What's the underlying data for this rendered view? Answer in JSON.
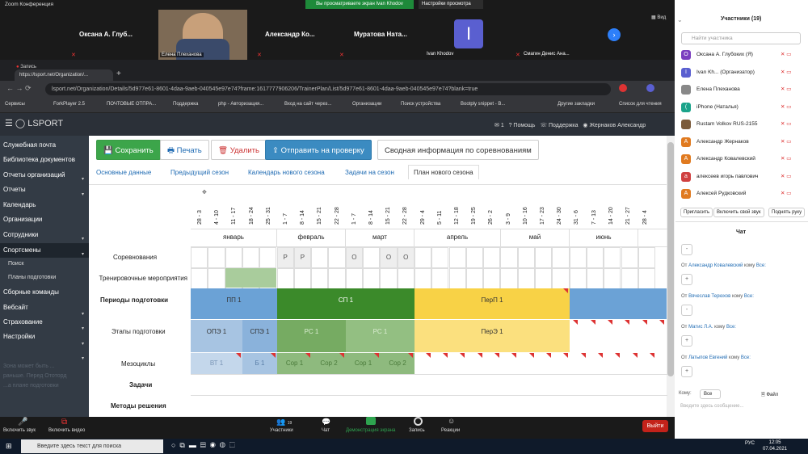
{
  "zoom": {
    "window_title": "Zoom Конференция",
    "sharing_banner": "Вы просматриваете экран Ivan Khodov",
    "view_options": "Настройки просмотра",
    "view_label": "Вид",
    "tiles": [
      {
        "name": "Оксана А. Глуб..."
      },
      {
        "name": "Елена Плеханова",
        "video": true
      },
      {
        "name": "Александр Ко..."
      },
      {
        "name": "Муратова Ната..."
      },
      {
        "name": "Ivan Khodov",
        "initial": "I"
      },
      {
        "name": "Смагин Денис Ана..."
      }
    ],
    "controls": {
      "mute": "Включить звук",
      "video": "Включить видео",
      "participants": "Участники",
      "participants_count": "19",
      "chat": "Чат",
      "share": "Демонстрация экрана",
      "record": "Запись",
      "reactions": "Реакции",
      "leave": "Выйти"
    }
  },
  "browser": {
    "recording_label": "Запись",
    "tab_title": "https://lsport.net/Organization/...",
    "url": "lsport.net/Organization/Details/5d977e61-8601-4daa-9aeb-040545e97e74?frame:1617777906206/TrainerPlan/List/5d977e61-8601-4daa-9aeb-040545e97e74?blank=true",
    "bookmarks": [
      "Сервисы",
      "ForkPlayer 2.5",
      "ПОЧТОВЫЕ ОТПРА...",
      "Поддержка",
      "php - Авторизация...",
      "Вход на сайт через...",
      "Организации",
      "Поиск устройства",
      "Bootply snippet - B...",
      "Другие закладки",
      "Список для чтения"
    ]
  },
  "app": {
    "logo": "LSPORT",
    "header": {
      "notifications": "1",
      "help": "Помощь",
      "support": "Поддержка",
      "user": "Жернаков Александр"
    },
    "sidebar": [
      {
        "label": "Служебная почта"
      },
      {
        "label": "Библиотека документов"
      },
      {
        "label": "Отчеты организаций",
        "arrow": true
      },
      {
        "label": "Отчеты",
        "arrow": true
      },
      {
        "label": "Календарь"
      },
      {
        "label": "Организации"
      },
      {
        "label": "Сотрудники",
        "arrow": true
      },
      {
        "label": "Спортсмены",
        "arrow": true,
        "active": true
      },
      {
        "label": "Поиск",
        "sub": true
      },
      {
        "label": "Планы подготовки",
        "sub": true
      },
      {
        "label": "Сборные команды",
        "arrow": true
      },
      {
        "label": "Вебсайт",
        "arrow": true
      },
      {
        "label": "Страхование",
        "arrow": true
      },
      {
        "label": "Настройки",
        "arrow": true
      }
    ],
    "sidebar_faded": "Зона может быть ...\nраньше. Перед Ототорд\n...а плане подготовки",
    "toolbar": {
      "save": "Сохранить",
      "print": "Печать",
      "delete": "Удалить",
      "submit": "Отправить на проверку",
      "summary": "Сводная информация по соревнованиям"
    },
    "tabs": [
      "Основные данные",
      "Предыдущий сезон",
      "Календарь нового сезона",
      "Задачи на сезон",
      "План нового сезона"
    ],
    "weeks": [
      "28 - 3",
      "4 - 10",
      "11 - 17",
      "18 - 24",
      "25 - 31",
      "1 - 7",
      "8 - 14",
      "15 - 21",
      "22 - 28",
      "1 - 7",
      "8 - 14",
      "15 - 21",
      "22 - 28",
      "29 - 4",
      "5 - 11",
      "12 - 18",
      "19 - 25",
      "26 - 2",
      "3 - 9",
      "10 - 16",
      "17 - 23",
      "24 - 30",
      "31 - 6",
      "7 - 13",
      "14 - 20",
      "21 - 27",
      "28 - 4"
    ],
    "months": [
      "январь",
      "февраль",
      "март",
      "апрель",
      "май",
      "июнь"
    ],
    "rows": {
      "competitions": "Соревнования",
      "training_events": "Тренировочные мероприятия",
      "periods": "Периоды подготовки",
      "stages": "Этапы подготовки",
      "mesocycles": "Мезоциклы",
      "tasks": "Задачи",
      "methods": "Методы решения"
    },
    "competition_marks": [
      "Р",
      "Р",
      "О",
      "О",
      "О"
    ],
    "periods": [
      "ПП 1",
      "СП 1",
      "ПерП 1"
    ],
    "stages": [
      "ОПЭ 1",
      "СПЭ 1",
      "РС 1",
      "РС 1",
      "ПерЭ 1"
    ],
    "mesocycles": [
      "ВТ 1",
      "Б 1",
      "Сор 1",
      "Сор 2",
      "Сор 1",
      "Сор 2"
    ]
  },
  "participants": {
    "title": "Участники (19)",
    "search_placeholder": "Найти участника",
    "list": [
      {
        "initial": "О",
        "name": "Оксана А. Глубоких (Я)",
        "color": "#7b3fbf"
      },
      {
        "initial": "I",
        "name": "Ivan Kh... (Организатор)",
        "color": "#5a5fd0"
      },
      {
        "initial": "",
        "name": "Елена Плеханова",
        "color": "#888"
      },
      {
        "initial": "(",
        "name": "iPhone (Наталья)",
        "color": "#1aa38a"
      },
      {
        "initial": "",
        "name": "Rustam Volkov RUS-2155",
        "color": "#7a5a3a"
      },
      {
        "initial": "А",
        "name": "Александр Жернаков",
        "color": "#e07a20"
      },
      {
        "initial": "А",
        "name": "Александр Ковалевский",
        "color": "#e07a20"
      },
      {
        "initial": "а",
        "name": "алексеев игорь павлович",
        "color": "#d04040"
      },
      {
        "initial": "А",
        "name": "Алексей Рудковский",
        "color": "#e07a20"
      }
    ],
    "invite": "Пригласить",
    "unmute_all": "Включить свой звук",
    "raise_hand": "Поднять руку"
  },
  "chat": {
    "title": "Чат",
    "messages": [
      {
        "from": "Александр Ковалевский",
        "to": "Все:",
        "text": "+"
      },
      {
        "from": "Вячеслав Терюхов",
        "to": "Все:",
        "text": "-"
      },
      {
        "from": "Матис Л.А.",
        "to": "Все:",
        "text": "+"
      },
      {
        "from": "Латыпов Евгений",
        "to": "Все:",
        "text": "+"
      }
    ],
    "first_bubble": "-",
    "to_label": "Кому:",
    "to_value": "Все",
    "file_label": "Файл",
    "input_placeholder": "Введите здесь сообщение..."
  },
  "taskbar": {
    "search_placeholder": "Введите здесь текст для поиска",
    "lang": "РУС",
    "time": "12:05",
    "date": "07.04.2021"
  }
}
